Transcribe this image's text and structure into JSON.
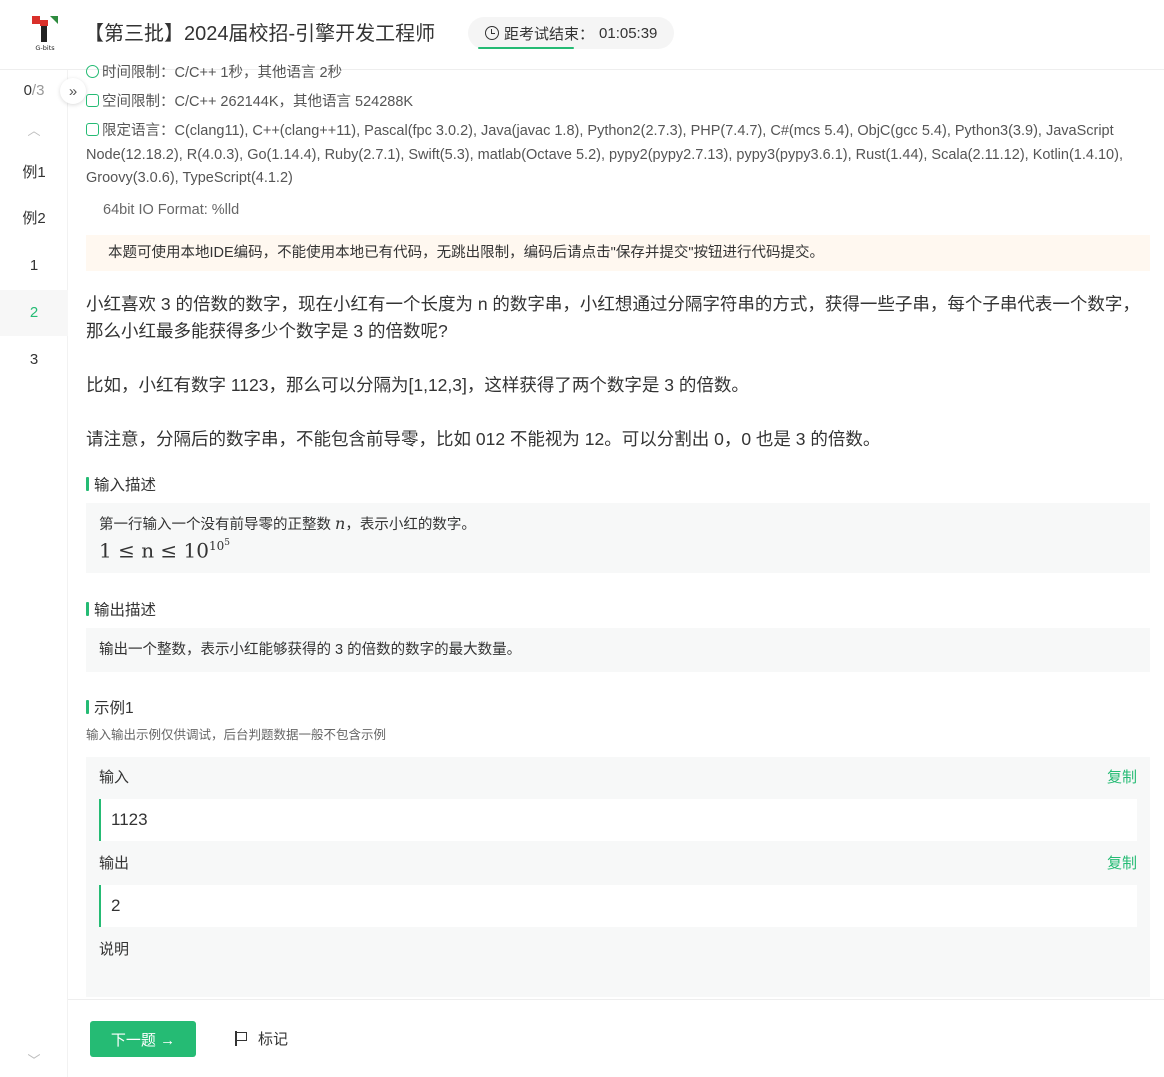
{
  "header": {
    "logo_text": "G-bits",
    "title": "【第三批】2024届校招-引擎开发工程师",
    "timer_label": "距考试结束：",
    "timer_value": "01:05:39"
  },
  "sidebar": {
    "progress_done": "0",
    "progress_total": "/3",
    "items": [
      {
        "label": "例1"
      },
      {
        "label": "例2"
      },
      {
        "label": "1"
      },
      {
        "label": "2"
      },
      {
        "label": "3"
      }
    ]
  },
  "problem": {
    "time_limit": "时间限制：C/C++ 1秒，其他语言 2秒",
    "space_limit": "空间限制：C/C++ 262144K，其他语言 524288K",
    "languages": "限定语言：C(clang11), C++(clang++11), Pascal(fpc 3.0.2), Java(javac 1.8), Python2(2.7.3), PHP(7.4.7), C#(mcs 5.4), ObjC(gcc 5.4), Python3(3.9), JavaScript Node(12.18.2), R(4.0.3), Go(1.14.4), Ruby(2.7.1), Swift(5.3), matlab(Octave 5.2), pypy2(pypy2.7.13), pypy3(pypy3.6.1), Rust(1.44), Scala(2.11.12), Kotlin(1.4.10), Groovy(3.0.6), TypeScript(4.1.2)",
    "io_format": "64bit IO Format: %lld",
    "notice": "本题可使用本地IDE编码，不能使用本地已有代码，无跳出限制，编码后请点击\"保存并提交\"按钮进行代码提交。",
    "desc_1": "小红喜欢 3 的倍数的数字，现在小红有一个长度为 n 的数字串，小红想通过分隔字符串的方式，获得一些子串，每个子串代表一个数字，那么小红最多能获得多少个数字是 3 的倍数呢?",
    "desc_2": "比如，小红有数字 1123，那么可以分隔为[1,12,3]，这样获得了两个数字是 3 的倍数。",
    "desc_3": "请注意，分隔后的数字串，不能包含前导零，比如 012 不能视为 12。可以分割出 0，0 也是 3 的倍数。",
    "input_title": "输入描述",
    "input_desc_prefix": "第一行输入一个没有前导零的正整数 ",
    "input_desc_var": "n",
    "input_desc_suffix": "，表示小红的数字。",
    "input_constraint_left": "1 ≤ n ≤ 10",
    "input_constraint_exp": "10",
    "input_constraint_exp2": "5",
    "output_title": "输出描述",
    "output_desc": "输出一个整数，表示小红能够获得的 3 的倍数的数字的最大数量。",
    "example_title": "示例1",
    "example_hint": "输入输出示例仅供调试，后台判题数据一般不包含示例",
    "example_input_label": "输入",
    "example_input_value": "1123",
    "example_output_label": "输出",
    "example_output_value": "2",
    "example_explain_label": "说明",
    "copy_label": "复制"
  },
  "footer": {
    "next_label": "下一题 →",
    "mark_label": "标记"
  },
  "colors": {
    "accent": "#25bb74",
    "notice_bg": "#fff8f0"
  }
}
